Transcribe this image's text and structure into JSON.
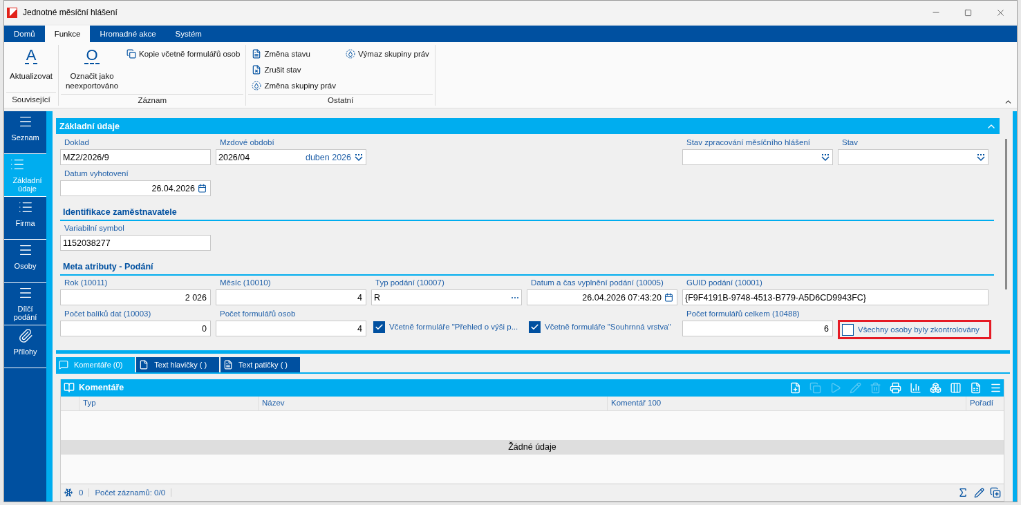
{
  "window": {
    "title": "Jednotné měsíční hlášení"
  },
  "ribbon": {
    "tabs": [
      {
        "label": "Domů",
        "selected": false
      },
      {
        "label": "Funkce",
        "selected": true
      },
      {
        "label": "Hromadné akce",
        "selected": false
      },
      {
        "label": "Systém",
        "selected": false
      }
    ],
    "groups": [
      {
        "label": "Související",
        "items": [
          {
            "kind": "large",
            "glyph": "A",
            "label": "Aktualizovat"
          }
        ]
      },
      {
        "label": "Záznam",
        "items": [
          {
            "kind": "large",
            "glyph": "O",
            "label": "Označit jako neexportováno"
          },
          {
            "kind": "small",
            "label": "Kopie včetně formulářů osob"
          }
        ]
      },
      {
        "label": "Ostatní",
        "items": [
          {
            "kind": "small",
            "label": "Změna stavu"
          },
          {
            "kind": "small",
            "label": "Zrušit stav"
          },
          {
            "kind": "small",
            "label": "Změna skupiny práv"
          },
          {
            "kind": "small",
            "label": "Výmaz skupiny práv"
          }
        ]
      }
    ]
  },
  "sidebar": {
    "items": [
      {
        "label": "Seznam",
        "selected": false
      },
      {
        "label": "Základní údaje",
        "selected": true
      },
      {
        "label": "Firma",
        "selected": false
      },
      {
        "label": "Osoby",
        "selected": false
      },
      {
        "label": "Dílčí podání",
        "selected": false
      },
      {
        "label": "Přílohy",
        "selected": false
      }
    ]
  },
  "form": {
    "title": "Základní údaje",
    "groups": [
      {
        "rows": [
          {
            "fields": [
              {
                "kind": "text",
                "label": "Doklad",
                "value": "MZ2/2026/9"
              },
              {
                "kind": "period",
                "label": "Mzdové období",
                "value": "2026/04",
                "note": "duben 2026"
              }
            ],
            "right_fields": [
              {
                "kind": "select",
                "label": "Stav zpracování měsíčního hlášení"
              },
              {
                "kind": "select",
                "label": "Stav"
              }
            ]
          },
          {
            "fields": [
              {
                "kind": "date",
                "label": "Datum vyhotovení",
                "value": "26.04.2026"
              }
            ]
          }
        ]
      },
      {
        "heading": "Identifikace zaměstnavatele",
        "rows": [
          {
            "fields": [
              {
                "kind": "text",
                "label": "Variabilní symbol",
                "value": "1152038277"
              }
            ]
          }
        ]
      },
      {
        "heading": "Meta atributy - Podání",
        "rows": [
          {
            "fields": [
              {
                "kind": "number",
                "label": "Rok (10011)",
                "value": "2 026"
              },
              {
                "kind": "number",
                "label": "Měsíc (10010)",
                "value": "4"
              },
              {
                "kind": "picker",
                "label": "Typ podání (10007)",
                "value": "R"
              },
              {
                "kind": "date",
                "label": "Datum a čas vyplnění podání (10005)",
                "value": "26.04.2026 07:43:20"
              },
              {
                "kind": "long_text",
                "label": "GUID podání (10001)",
                "value": "{F9F4191B-9748-4513-B779-A5D6CD9943FC}"
              }
            ]
          },
          {
            "fields": [
              {
                "kind": "number",
                "label": "Počet balíků dat (10003)",
                "value": "0"
              },
              {
                "kind": "number",
                "label": "Počet formulářů osob",
                "value": "4"
              },
              {
                "kind": "checkbox",
                "text": "Včetně formuláře \"Přehled o výši p...",
                "checked": true,
                "marked": false
              },
              {
                "kind": "checkbox",
                "text": "Včetně formuláře \"Souhrnná vrstva\"",
                "checked": true,
                "marked": false
              },
              {
                "kind": "number",
                "label": "Počet formulářů celkem (10488)",
                "value": "6"
              },
              {
                "kind": "checkbox",
                "text": "Všechny osoby byly zkontrolovány",
                "checked": false,
                "marked": true
              }
            ]
          }
        ]
      }
    ]
  },
  "bottom_tabs": [
    {
      "label": "Komentáře (0)",
      "selected": true
    },
    {
      "label": "Text hlavičky ( )",
      "selected": false
    },
    {
      "label": "Text patičky ( )",
      "selected": false
    }
  ],
  "grid": {
    "title": "Komentáře",
    "toolbar": [
      {
        "kind": "new",
        "disabled": false
      },
      {
        "kind": "copy",
        "disabled": true
      },
      {
        "kind": "run",
        "disabled": true
      },
      {
        "kind": "edit",
        "disabled": true
      },
      {
        "kind": "delete",
        "disabled": true
      },
      {
        "kind": "print",
        "disabled": false
      },
      {
        "kind": "chart",
        "disabled": false
      },
      {
        "kind": "cubes",
        "disabled": false
      },
      {
        "kind": "columns",
        "disabled": false
      },
      {
        "kind": "excel",
        "disabled": false
      },
      {
        "kind": "menu",
        "disabled": false
      }
    ],
    "columns": [
      "Typ",
      "Název",
      "Komentář 100",
      "Pořadí"
    ],
    "empty_message": "Žádné údaje",
    "footer": {
      "filter_count": "0",
      "records": "Počet záznamů: 0/0"
    }
  }
}
